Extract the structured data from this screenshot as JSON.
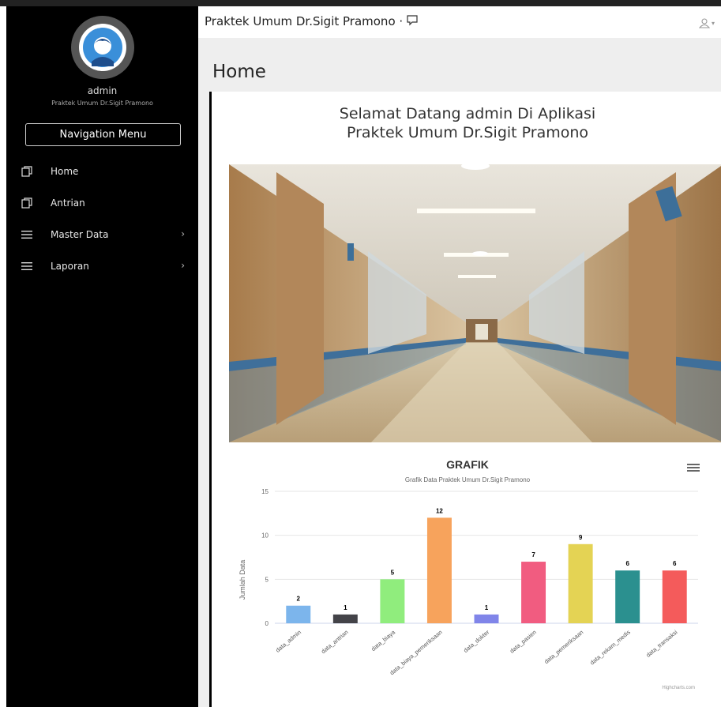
{
  "sidebar": {
    "user_name": "admin",
    "user_subtitle": "Praktek Umum Dr.Sigit Pramono",
    "nav_menu_label": "Navigation Menu",
    "items": [
      {
        "label": "Home",
        "icon": "copy-icon",
        "has_submenu": false
      },
      {
        "label": "Antrian",
        "icon": "copy-icon",
        "has_submenu": false
      },
      {
        "label": "Master Data",
        "icon": "bars-icon",
        "has_submenu": true
      },
      {
        "label": "Laporan",
        "icon": "bars-icon",
        "has_submenu": true
      }
    ]
  },
  "header": {
    "brand": "Praktek Umum Dr.Sigit Pramono ·",
    "brand_icon": "comment-icon",
    "user_icon": "user-icon"
  },
  "main": {
    "page_title": "Home",
    "welcome_line1": "Selamat Datang admin Di Aplikasi",
    "welcome_line2": "Praktek Umum Dr.Sigit Pramono",
    "hero_image": "hospital-corridor-image"
  },
  "chart_data": {
    "type": "bar",
    "title": "GRAFIK",
    "subtitle": "Grafik Data Praktek Umum Dr.Sigit Pramono",
    "xlabel": "",
    "ylabel": "Jumlah Data",
    "ylim": [
      0,
      15
    ],
    "yticks": [
      0,
      5,
      10,
      15
    ],
    "grid": true,
    "categories": [
      "data_admin",
      "data_antrian",
      "data_biaya",
      "data_biaya_pemeriksaan",
      "data_dokter",
      "data_pasien",
      "data_pemeriksaan",
      "data_rekam_medis",
      "data_transaksi"
    ],
    "values": [
      2,
      1,
      5,
      12,
      1,
      7,
      9,
      6,
      6
    ],
    "colors": [
      "#7cb5ec",
      "#434348",
      "#90ed7d",
      "#f7a35c",
      "#8085e9",
      "#f15c80",
      "#e4d354",
      "#2b908f",
      "#f45b5b"
    ],
    "credits": "Highcharts.com"
  }
}
